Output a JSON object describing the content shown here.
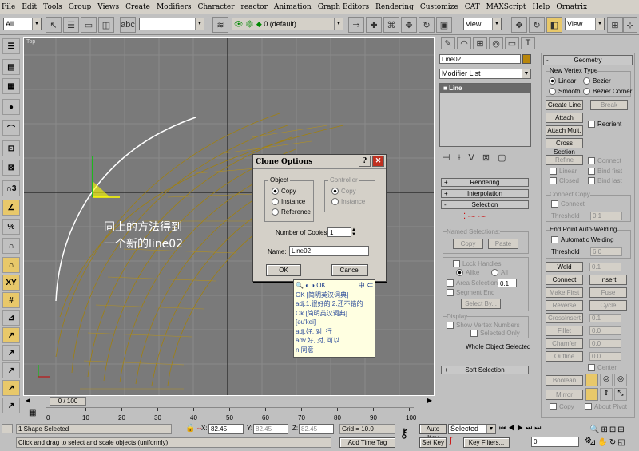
{
  "menu": [
    "File",
    "Edit",
    "Tools",
    "Group",
    "Views",
    "Create",
    "Modifiers",
    "Character",
    "reactor",
    "Animation",
    "Graph Editors",
    "Rendering",
    "Customize",
    "CAT",
    "MAXScript",
    "Help",
    "Ornatrix"
  ],
  "toolbar": {
    "selection_filter": "All",
    "layer": "0 (default)",
    "ref_coord": "View",
    "ref_coord2": "View"
  },
  "viewport": {
    "label": "Top",
    "annotation_line1": "同上的方法得到",
    "annotation_line2": "一个新的line02"
  },
  "dialog": {
    "title": "Clone Options",
    "object_group": "Object",
    "copy": "Copy",
    "instance": "Instance",
    "reference": "Reference",
    "controller_group": "Controller",
    "ctrl_copy": "Copy",
    "ctrl_instance": "Instance",
    "num_copies_label": "Number of Copies:",
    "num_copies": "1",
    "name_label": "Name:",
    "name": "Line02",
    "ok": "OK",
    "cancel": "Cancel"
  },
  "tooltip": {
    "header": "OK",
    "lines": [
      "OK [简明英汉词典]",
      "adj.1.很好的 2.还不错的",
      "Ok [简明英汉词典]",
      "[əu'kei]",
      "adj.好, 对, 行",
      "adv.好, 对, 可以",
      "n.同意"
    ]
  },
  "cmd": {
    "object_name": "Line02",
    "modifier_list": "Modifier List",
    "stack_item": "Line",
    "rollouts": {
      "rendering": "Rendering",
      "interpolation": "Interpolation",
      "selection": "Selection",
      "soft_selection": "Soft Selection"
    },
    "named_selections": "Named Selections:",
    "copy_btn": "Copy",
    "paste_btn": "Paste",
    "lock_handles": "Lock Handles",
    "alike": "Alike",
    "all": "All",
    "area_selection": "Area Selection:",
    "area_value": "0.1",
    "segment_end": "Segment End",
    "select_by": "Select By...",
    "display": "Display",
    "show_vertex_numbers": "Show Vertex Numbers",
    "selected_only": "Selected Only",
    "whole_object_selected": "Whole Object Selected"
  },
  "geometry": {
    "title": "Geometry",
    "new_vertex_type": "New Vertex Type",
    "linear": "Linear",
    "bezier": "Bezier",
    "smooth": "Smooth",
    "bezier_corner": "Bezier Corner",
    "create_line": "Create Line",
    "break": "Break",
    "attach": "Attach",
    "reorient": "Reorient",
    "attach_mult": "Attach Mult.",
    "cross_section": "Cross Section",
    "refine": "Refine",
    "connect": "Connect",
    "linear2": "Linear",
    "bind_first": "Bind first",
    "closed": "Closed",
    "bind_last": "Bind last",
    "connect_copy": "Connect Copy",
    "connect2": "Connect",
    "threshold": "Threshold",
    "threshold_val": "0.1",
    "end_point": "End Point Auto-Welding",
    "auto_weld": "Automatic Welding",
    "threshold2": "Threshold",
    "threshold2_val": "6.0",
    "weld": "Weld",
    "weld_val": "0.1",
    "connect3": "Connect",
    "insert": "Insert",
    "make_first": "Make First",
    "fuse": "Fuse",
    "reverse": "Reverse",
    "cycle": "Cycle",
    "crossinsert": "CrossInsert",
    "crossinsert_val": "0.1",
    "fillet": "Fillet",
    "fillet_val": "0.0",
    "chamfer": "Chamfer",
    "chamfer_val": "0.0",
    "outline": "Outline",
    "outline_val": "0.0",
    "center": "Center",
    "boolean": "Boolean",
    "mirror": "Mirror",
    "copy": "Copy",
    "about_pivot": "About Pivot"
  },
  "timeline": {
    "frame": "0 / 100",
    "ticks": [
      "0",
      "10",
      "20",
      "30",
      "40",
      "50",
      "60",
      "70",
      "80",
      "90",
      "100"
    ]
  },
  "status": {
    "selected": "1 Shape Selected",
    "prompt": "Click and drag to select and scale objects (uniformly)",
    "x_label": "X:",
    "x": "82.45",
    "y_label": "Y:",
    "y": "82.45",
    "z_label": "Z:",
    "z": "82.45",
    "grid": "Grid = 10.0",
    "add_time_tag": "Add Time Tag",
    "auto_key": "Auto Key",
    "set_key": "Set Key",
    "selected_dd": "Selected",
    "key_filters": "Key Filters...",
    "frame_field": "0"
  }
}
